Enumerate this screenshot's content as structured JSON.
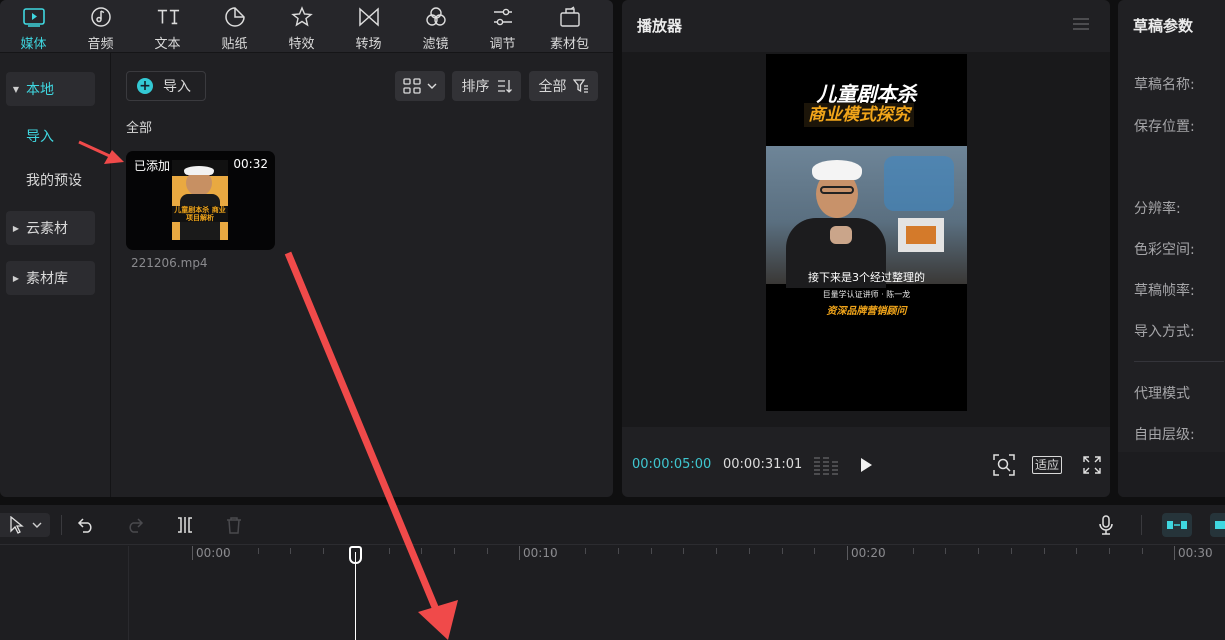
{
  "colors": {
    "accent": "#3fd7e0",
    "annotation": "#f04a4a",
    "highlight": "#f1a51a"
  },
  "top_tabs": [
    {
      "label": "媒体",
      "icon": "media-icon"
    },
    {
      "label": "音频",
      "icon": "music-note-icon"
    },
    {
      "label": "文本",
      "icon": "text-icon"
    },
    {
      "label": "贴纸",
      "icon": "sticker-icon"
    },
    {
      "label": "特效",
      "icon": "sparkle-star-icon"
    },
    {
      "label": "转场",
      "icon": "transition-bowtie-icon"
    },
    {
      "label": "滤镜",
      "icon": "filter-circles-icon"
    },
    {
      "label": "调节",
      "icon": "adjust-sliders-icon"
    },
    {
      "label": "素材包",
      "icon": "material-pack-icon"
    }
  ],
  "side_nav": {
    "local": "本地",
    "import": "导入",
    "my_presets": "我的预设",
    "cloud": "云素材",
    "library": "素材库"
  },
  "toolbar": {
    "import": "导入",
    "sort": "排序",
    "all": "全部"
  },
  "section_label": "全部",
  "media_item": {
    "badge": "已添加",
    "duration": "00:32",
    "filename": "221206.mp4",
    "thumb_caption": "儿童剧本杀 商业项目解析"
  },
  "player": {
    "title": "播放器",
    "video": {
      "title1": "儿童剧本杀",
      "title2": "商业模式探究",
      "subtitle": "接下来是3个经过整理的",
      "credit": "巨量学认证讲师 · 陈一龙",
      "tag": "资深品牌营销顾问"
    },
    "current_time": "00:00:05:00",
    "total_time": "00:00:31:01",
    "fit_label": "适应"
  },
  "params": {
    "title": "草稿参数",
    "labels": [
      "草稿名称:",
      "保存位置:",
      "分辨率:",
      "色彩空间:",
      "草稿帧率:",
      "导入方式:",
      "代理模式",
      "自由层级:"
    ]
  },
  "timeline": {
    "ticks": [
      "00:00",
      "00:10",
      "00:20",
      "00:30"
    ]
  }
}
